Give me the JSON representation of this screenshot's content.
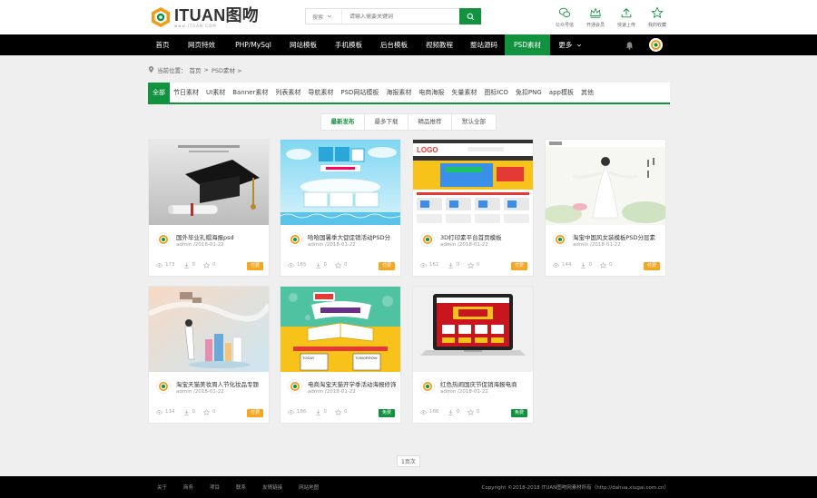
{
  "header": {
    "logo_text": "ITUAN图吻",
    "logo_sub": "www.ITUAN.COM",
    "search_type": "搜索",
    "search_placeholder": "请输入需要关键词",
    "tools": [
      {
        "icon": "wechat-icon",
        "label": "公众号信"
      },
      {
        "icon": "crown-icon",
        "label": "开通会员"
      },
      {
        "icon": "upload-icon",
        "label": "快速上传"
      },
      {
        "icon": "star-icon",
        "label": "我的收藏"
      }
    ]
  },
  "nav": {
    "items": [
      "首页",
      "网页特效",
      "PHP/MySql",
      "网站模板",
      "手机模板",
      "后台模板",
      "视频教程",
      "整站源码",
      "PSD素材",
      "更多"
    ],
    "active": "PSD素材"
  },
  "breadcrumb": {
    "prefix": "当前位置：",
    "home": "首页",
    "current": "PSD素材 >",
    "sep": ">"
  },
  "categories": [
    "全部",
    "节日素材",
    "UI素材",
    "Banner素材",
    "列表素材",
    "导航素材",
    "PSD网站模板",
    "海报素材",
    "电商海报",
    "矢量素材",
    "图标ICO",
    "免扣PNG",
    "app模板",
    "其他"
  ],
  "sorts": [
    "最新发布",
    "最多下载",
    "精品推荐",
    "默认全部"
  ],
  "cards": [
    {
      "title": "国外毕业礼帽海报psd",
      "author": "admin",
      "date": "/2018-01-22",
      "views": "173",
      "downloads": "0",
      "favs": "0",
      "badge": "付费",
      "badge_color": "#f5a623"
    },
    {
      "title": "哈哈国暑季大促促销活动PSD分",
      "author": "admin",
      "date": "/2018-01-22",
      "views": "165",
      "downloads": "0",
      "favs": "0",
      "badge": "付费",
      "badge_color": "#f5a623"
    },
    {
      "title": "3D打印素平台首页模板",
      "author": "admin",
      "date": "/2018-01-22",
      "views": "161",
      "downloads": "0",
      "favs": "0",
      "badge": "付费",
      "badge_color": "#f5a623"
    },
    {
      "title": "淘宝中国风女装模板PSD分层素",
      "author": "admin",
      "date": "/2018-01-22",
      "views": "144",
      "downloads": "0",
      "favs": "0",
      "badge": "付费",
      "badge_color": "#f5a623"
    },
    {
      "title": "淘宝天猫美妆周人节化妆品专题",
      "author": "admin",
      "date": "/2018-01-22",
      "views": "114",
      "downloads": "0",
      "favs": "0",
      "badge": "付费",
      "badge_color": "#f5a623"
    },
    {
      "title": "电商淘宝天猫开学季活动海报修饰",
      "author": "admin",
      "date": "/2018-01-22",
      "views": "186",
      "downloads": "0",
      "favs": "0",
      "badge": "免费",
      "badge_color": "#11923f"
    },
    {
      "title": "红色热闹国庆节促销海报电商",
      "author": "admin",
      "date": "/2018-01-22",
      "views": "186",
      "downloads": "0",
      "favs": "0",
      "badge": "免费",
      "badge_color": "#11923f"
    }
  ],
  "pager": {
    "label": "1页次"
  },
  "footer": {
    "links": [
      "关于",
      "商务",
      "项目",
      "联系",
      "友情链接",
      "网站地图"
    ],
    "copyright": "Copyright ©2018-2018 ITUAN图吻网素材所有（http://dahua.xiugai.com.cn）"
  },
  "colors": {
    "brand": "#11923f",
    "logo_orange": "#f29b16",
    "paid": "#f5a623"
  }
}
